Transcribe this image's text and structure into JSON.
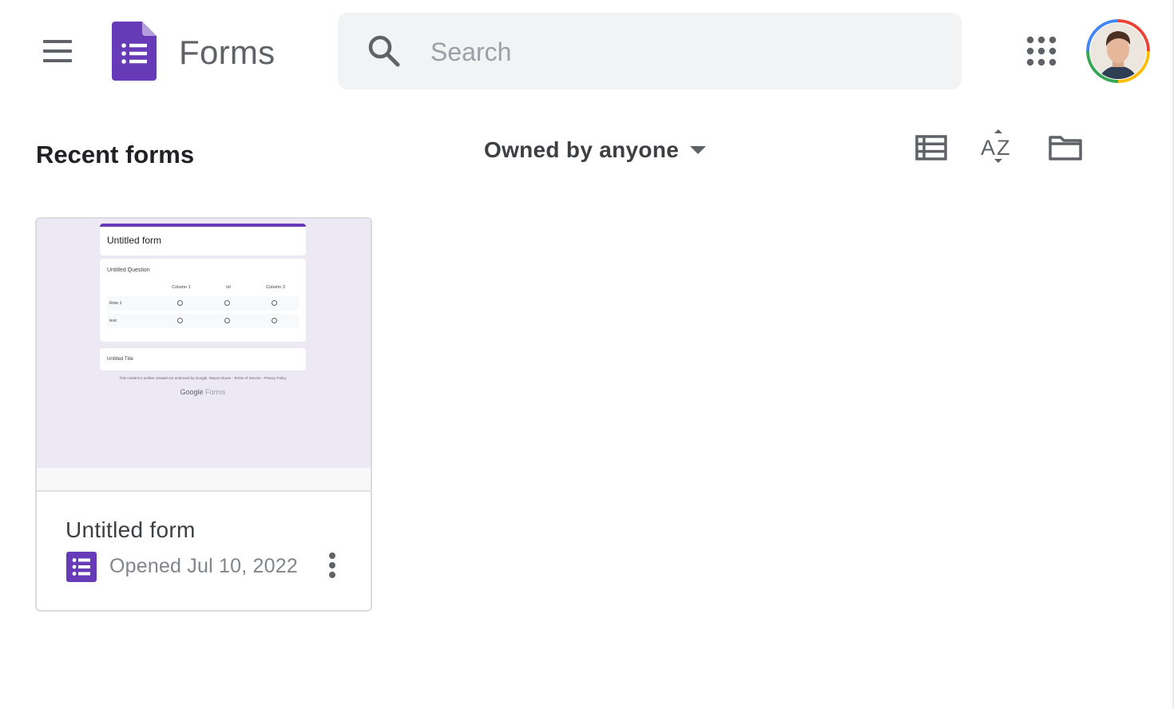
{
  "header": {
    "menu_icon": "hamburger-menu-icon",
    "app_name": "Forms",
    "search": {
      "placeholder": "Search",
      "value": ""
    },
    "apps_icon": "apps-grid-icon",
    "avatar_icon": "user-avatar"
  },
  "toolbar": {
    "section_title": "Recent forms",
    "owner_filter": "Owned by anyone",
    "icons": [
      "list-view-icon",
      "sort-az-icon",
      "folder-icon"
    ]
  },
  "forms": [
    {
      "title": "Untitled form",
      "opened": "Opened Jul 10, 2022",
      "thumbnail": {
        "form_title": "Untitled form",
        "question": "Untitled Question",
        "columns": [
          "Column 1",
          "lol",
          "Column 3"
        ],
        "rows": [
          "Row 1",
          "test"
        ],
        "section_title": "Untitled Title",
        "footer": "This content is neither created nor endorsed by Google. Report Abuse - Terms of Service - Privacy Policy",
        "brand_google": "Google",
        "brand_forms": "Forms"
      }
    }
  ],
  "colors": {
    "brand": "#673ab7",
    "icon_gray": "#5f6368",
    "search_bg": "#f1f3f4"
  }
}
